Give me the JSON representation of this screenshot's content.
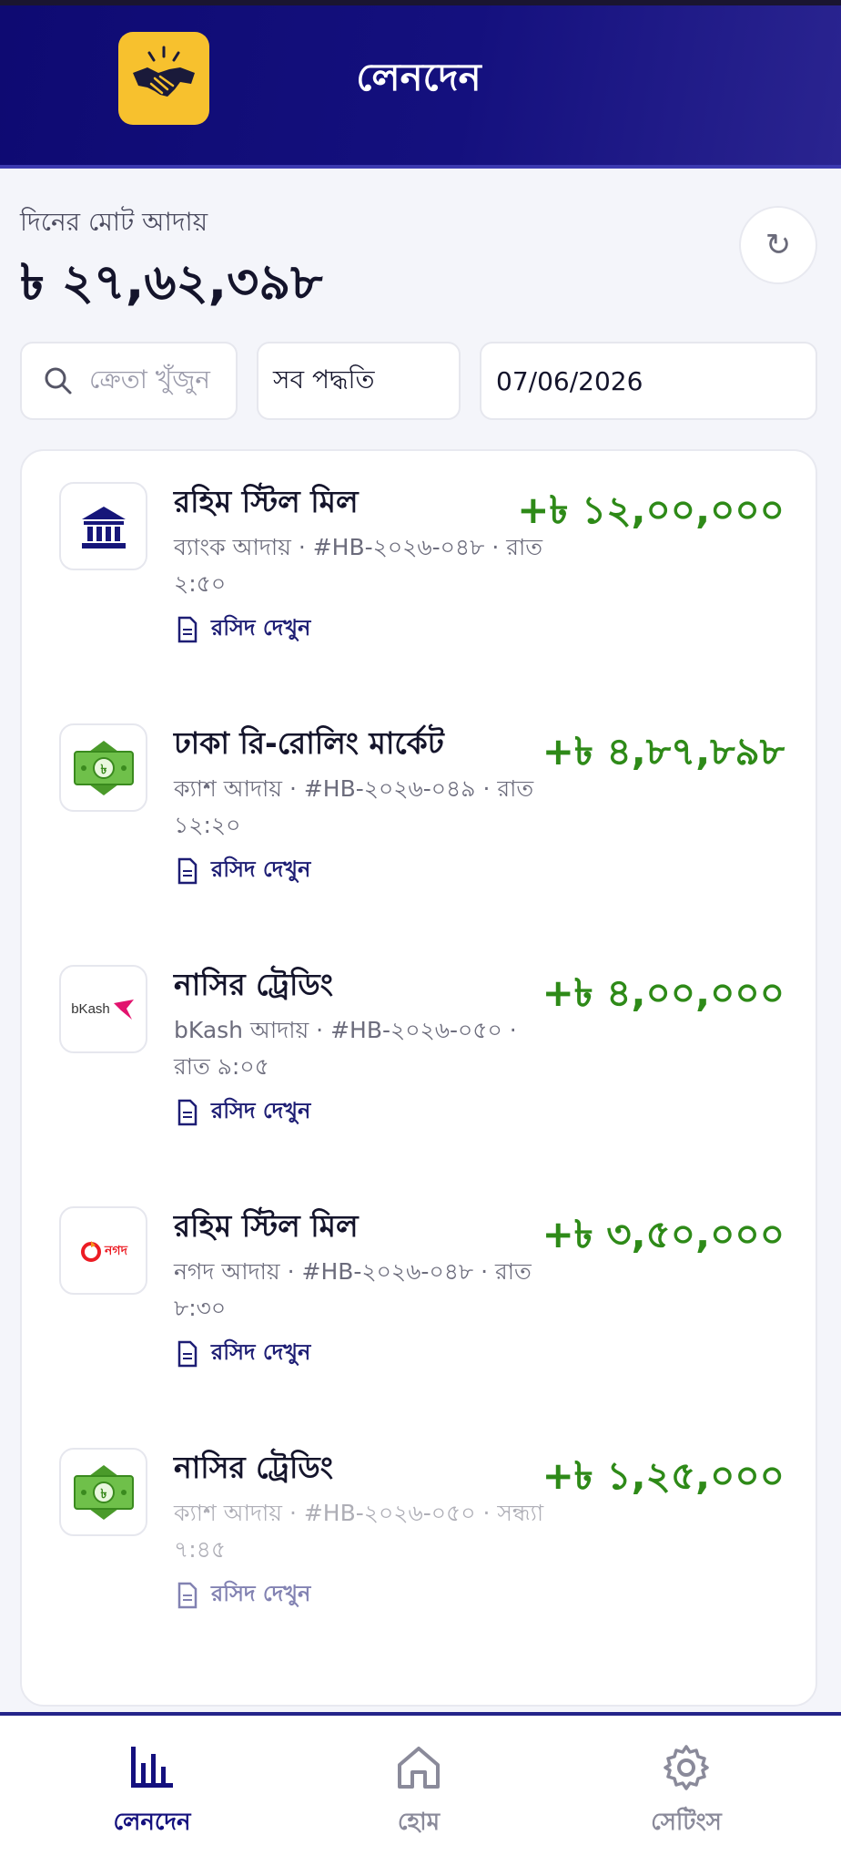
{
  "header": {
    "title": "লেনদেন"
  },
  "summary": {
    "label": "দিনের মোট আদায়",
    "total": "৳ ২৭,৬২,৩৯৮"
  },
  "filters": {
    "search_placeholder": "ক্রেতা খুঁজুন",
    "method": "সব পদ্ধতি",
    "date": "07/06/2026"
  },
  "transactions": [
    {
      "name": "রহিম স্টিল মিল",
      "meta": "ব্যাংক আদায় · #HB-২০২৬-০৪৮ · রাত ২:৫০",
      "receipt": "রসিদ দেখুন",
      "amount": "+৳ ১২,০০,০০০",
      "icon": "bank-icon"
    },
    {
      "name": "ঢাকা রি-রোলিং মার্কেট",
      "meta": "ক্যাশ আদায় · #HB-২০২৬-০৪৯ · রাত ১২:২০",
      "receipt": "রসিদ দেখুন",
      "amount": "+৳ ৪,৮৭,৮৯৮",
      "icon": "cash-icon"
    },
    {
      "name": "নাসির ট্রেডিং",
      "meta": "bKash আদায় · #HB-২০২৬-০৫০ · রাত ৯:০৫",
      "receipt": "রসিদ দেখুন",
      "amount": "+৳ ৪,০০,০০০",
      "icon": "bkash-icon",
      "icon_text": "bKash"
    },
    {
      "name": "রহিম স্টিল মিল",
      "meta": "নগদ আদায় · #HB-২০২৬-০৪৮ · রাত ৮:৩০",
      "receipt": "রসিদ দেখুন",
      "amount": "+৳ ৩,৫০,০০০",
      "icon": "nagad-icon",
      "icon_text": "নগদ"
    },
    {
      "name": "নাসির ট্রেডিং",
      "meta": "ক্যাশ আদায় · #HB-২০২৬-০৫০ · সন্ধ্যা ৭:৪৫",
      "receipt": "রসিদ দেখুন",
      "amount": "+৳ ১,২৫,০০০",
      "icon": "cash-icon"
    }
  ],
  "nav": {
    "transactions": "লেনদেন",
    "home": "হোম",
    "settings": "সেটিংস"
  },
  "colors": {
    "primary": "#14107e",
    "accent": "#f7c12e",
    "amount": "#2e8a18",
    "background": "#f4f5fa"
  }
}
